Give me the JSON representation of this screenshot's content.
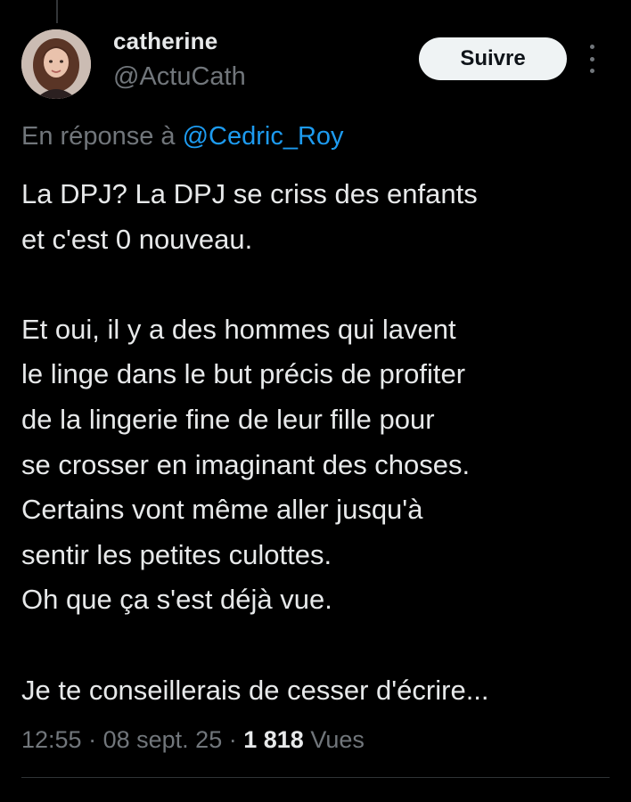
{
  "author": {
    "display_name": "catherine",
    "handle": "@ActuCath",
    "avatar_icon": "avatar-photo"
  },
  "actions": {
    "follow_label": "Suivre",
    "more_icon": "more-vertical-icon"
  },
  "reply_context": {
    "prefix": "En réponse à",
    "mention": "@Cedric_Roy"
  },
  "tweet": {
    "text": "La DPJ? La DPJ se criss des enfants\net c'est 0 nouveau.\n\nEt oui, il y a des hommes qui lavent\nle linge dans le but précis de profiter\nde la lingerie fine de leur fille pour\nse crosser en imaginant des choses.\nCertains vont même aller jusqu'à\nsentir les petites culottes.\nOh que ça s'est déjà vue.\n\nJe te conseillerais de cesser d'écrire..."
  },
  "meta": {
    "time": "12:55",
    "separator": "·",
    "date": "08 sept. 25",
    "views_count": "1 818",
    "views_label": "Vues"
  },
  "colors": {
    "background": "#000000",
    "text_primary": "#e7e9ea",
    "text_secondary": "#71767b",
    "link": "#1d9bf0",
    "button_bg": "#eff3f4",
    "button_text": "#0f1419"
  }
}
